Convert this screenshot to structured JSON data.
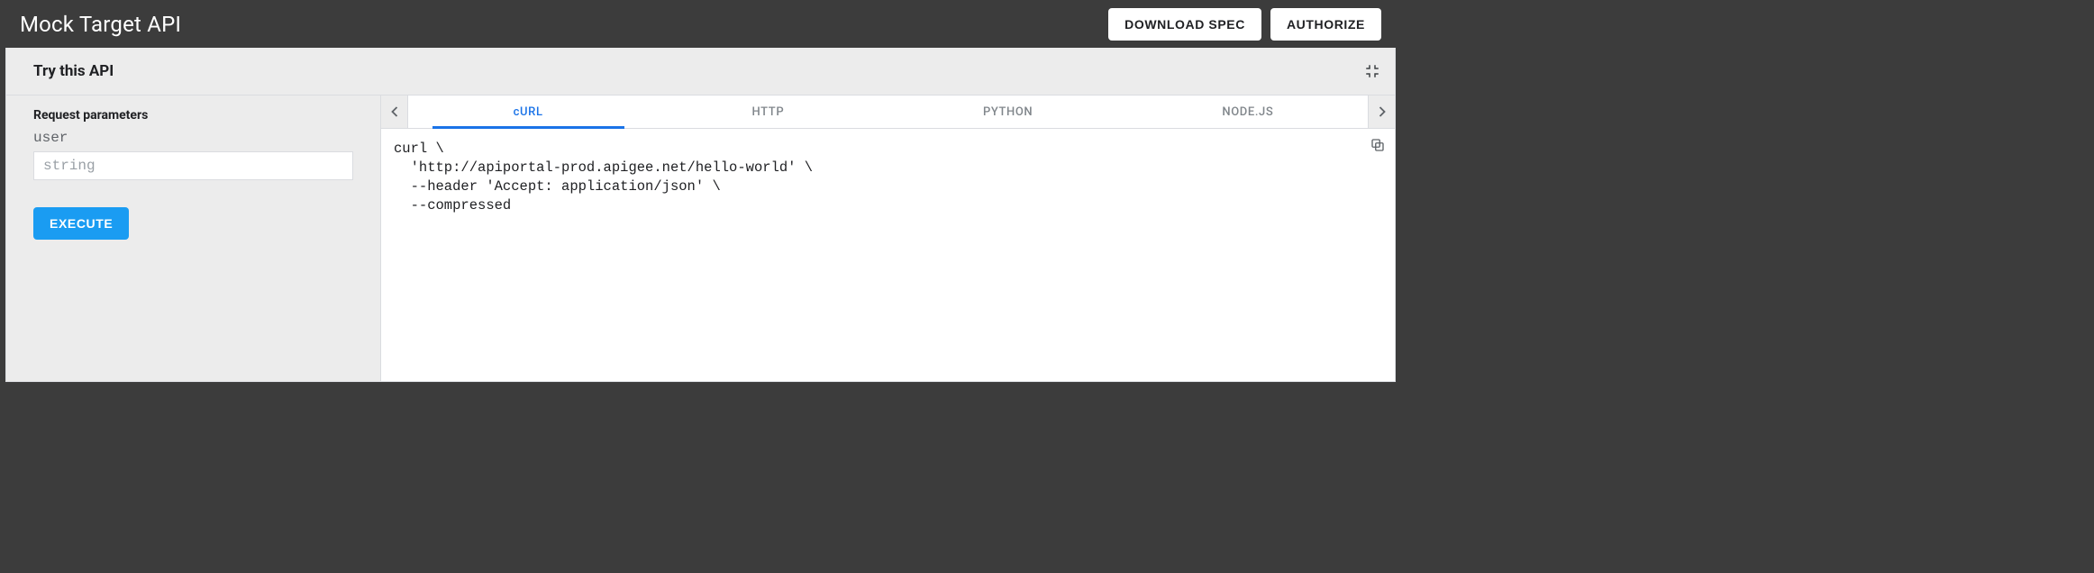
{
  "topbar": {
    "title": "Mock Target API",
    "download_label": "DOWNLOAD SPEC",
    "authorize_label": "AUTHORIZE"
  },
  "panel": {
    "title": "Try this API"
  },
  "request": {
    "section_label": "Request parameters",
    "param_name": "user",
    "param_placeholder": "string",
    "execute_label": "EXECUTE"
  },
  "code_tabs": {
    "items": [
      {
        "label": "cURL",
        "active": true
      },
      {
        "label": "HTTP",
        "active": false
      },
      {
        "label": "PYTHON",
        "active": false
      },
      {
        "label": "NODE.JS",
        "active": false
      }
    ]
  },
  "code_sample": "curl \\\n  'http://apiportal-prod.apigee.net/hello-world' \\\n  --header 'Accept: application/json' \\\n  --compressed"
}
